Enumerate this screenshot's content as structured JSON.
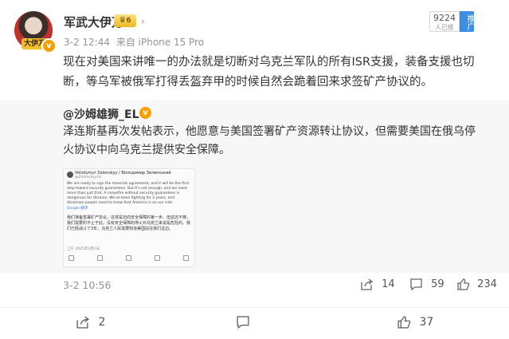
{
  "post": {
    "author": "军武大伊万",
    "level_badge": "6",
    "avatar_tag": "大伊万",
    "time": "3-2 12:44",
    "source": "来自 iPhone 15 Pro",
    "text": "现在对美国来讲唯一的办法就是切断对乌克兰军队的所有ISR支援，装备支援也切断，等乌军被俄军打得丢盔弃甲的时候自然会跪着回来求签矿产协议的。",
    "push": {
      "count": "9224",
      "sub": "人已推",
      "label": "推广"
    }
  },
  "repost": {
    "author": "@沙姆雄狮_EL",
    "text": "泽连斯基再次发帖表示，他愿意与美国签署矿产资源转让协议，但需要美国在俄乌停火协议中向乌克兰提供安全保障。",
    "time": "3-2 10:56",
    "shares": "14",
    "comments": "59",
    "likes": "234",
    "image": {
      "name": "Volodymyr Zelenskyy / Володимир Зеленський",
      "handle": "@ZelenskyyUa",
      "body": "We are ready to sign the minerals agreement, and it will be the first step toward security guarantees. But it's not enough, and we need more than just that. A ceasefire without security guarantees is dangerous for Ukraine. We've been fighting for 3 years, and Ukrainian people need to know that America is on our side.",
      "translated_label": "Google 翻译",
      "translated": "我们准备签署矿产协议，这将是迈向安全保障的第一步。但这还不够，我们需要的不止于此。没有安全保障的停火对乌克兰来说是危险的。我们已经战斗了3年，乌克兰人民需要知道美国站在我们这边。",
      "timestamp": "上午 2025年3月1日"
    }
  },
  "actions": {
    "shares": "2",
    "comments": "",
    "likes": "37"
  },
  "colors": {
    "accent": "#f59f00",
    "push": "#3a8ee6"
  }
}
